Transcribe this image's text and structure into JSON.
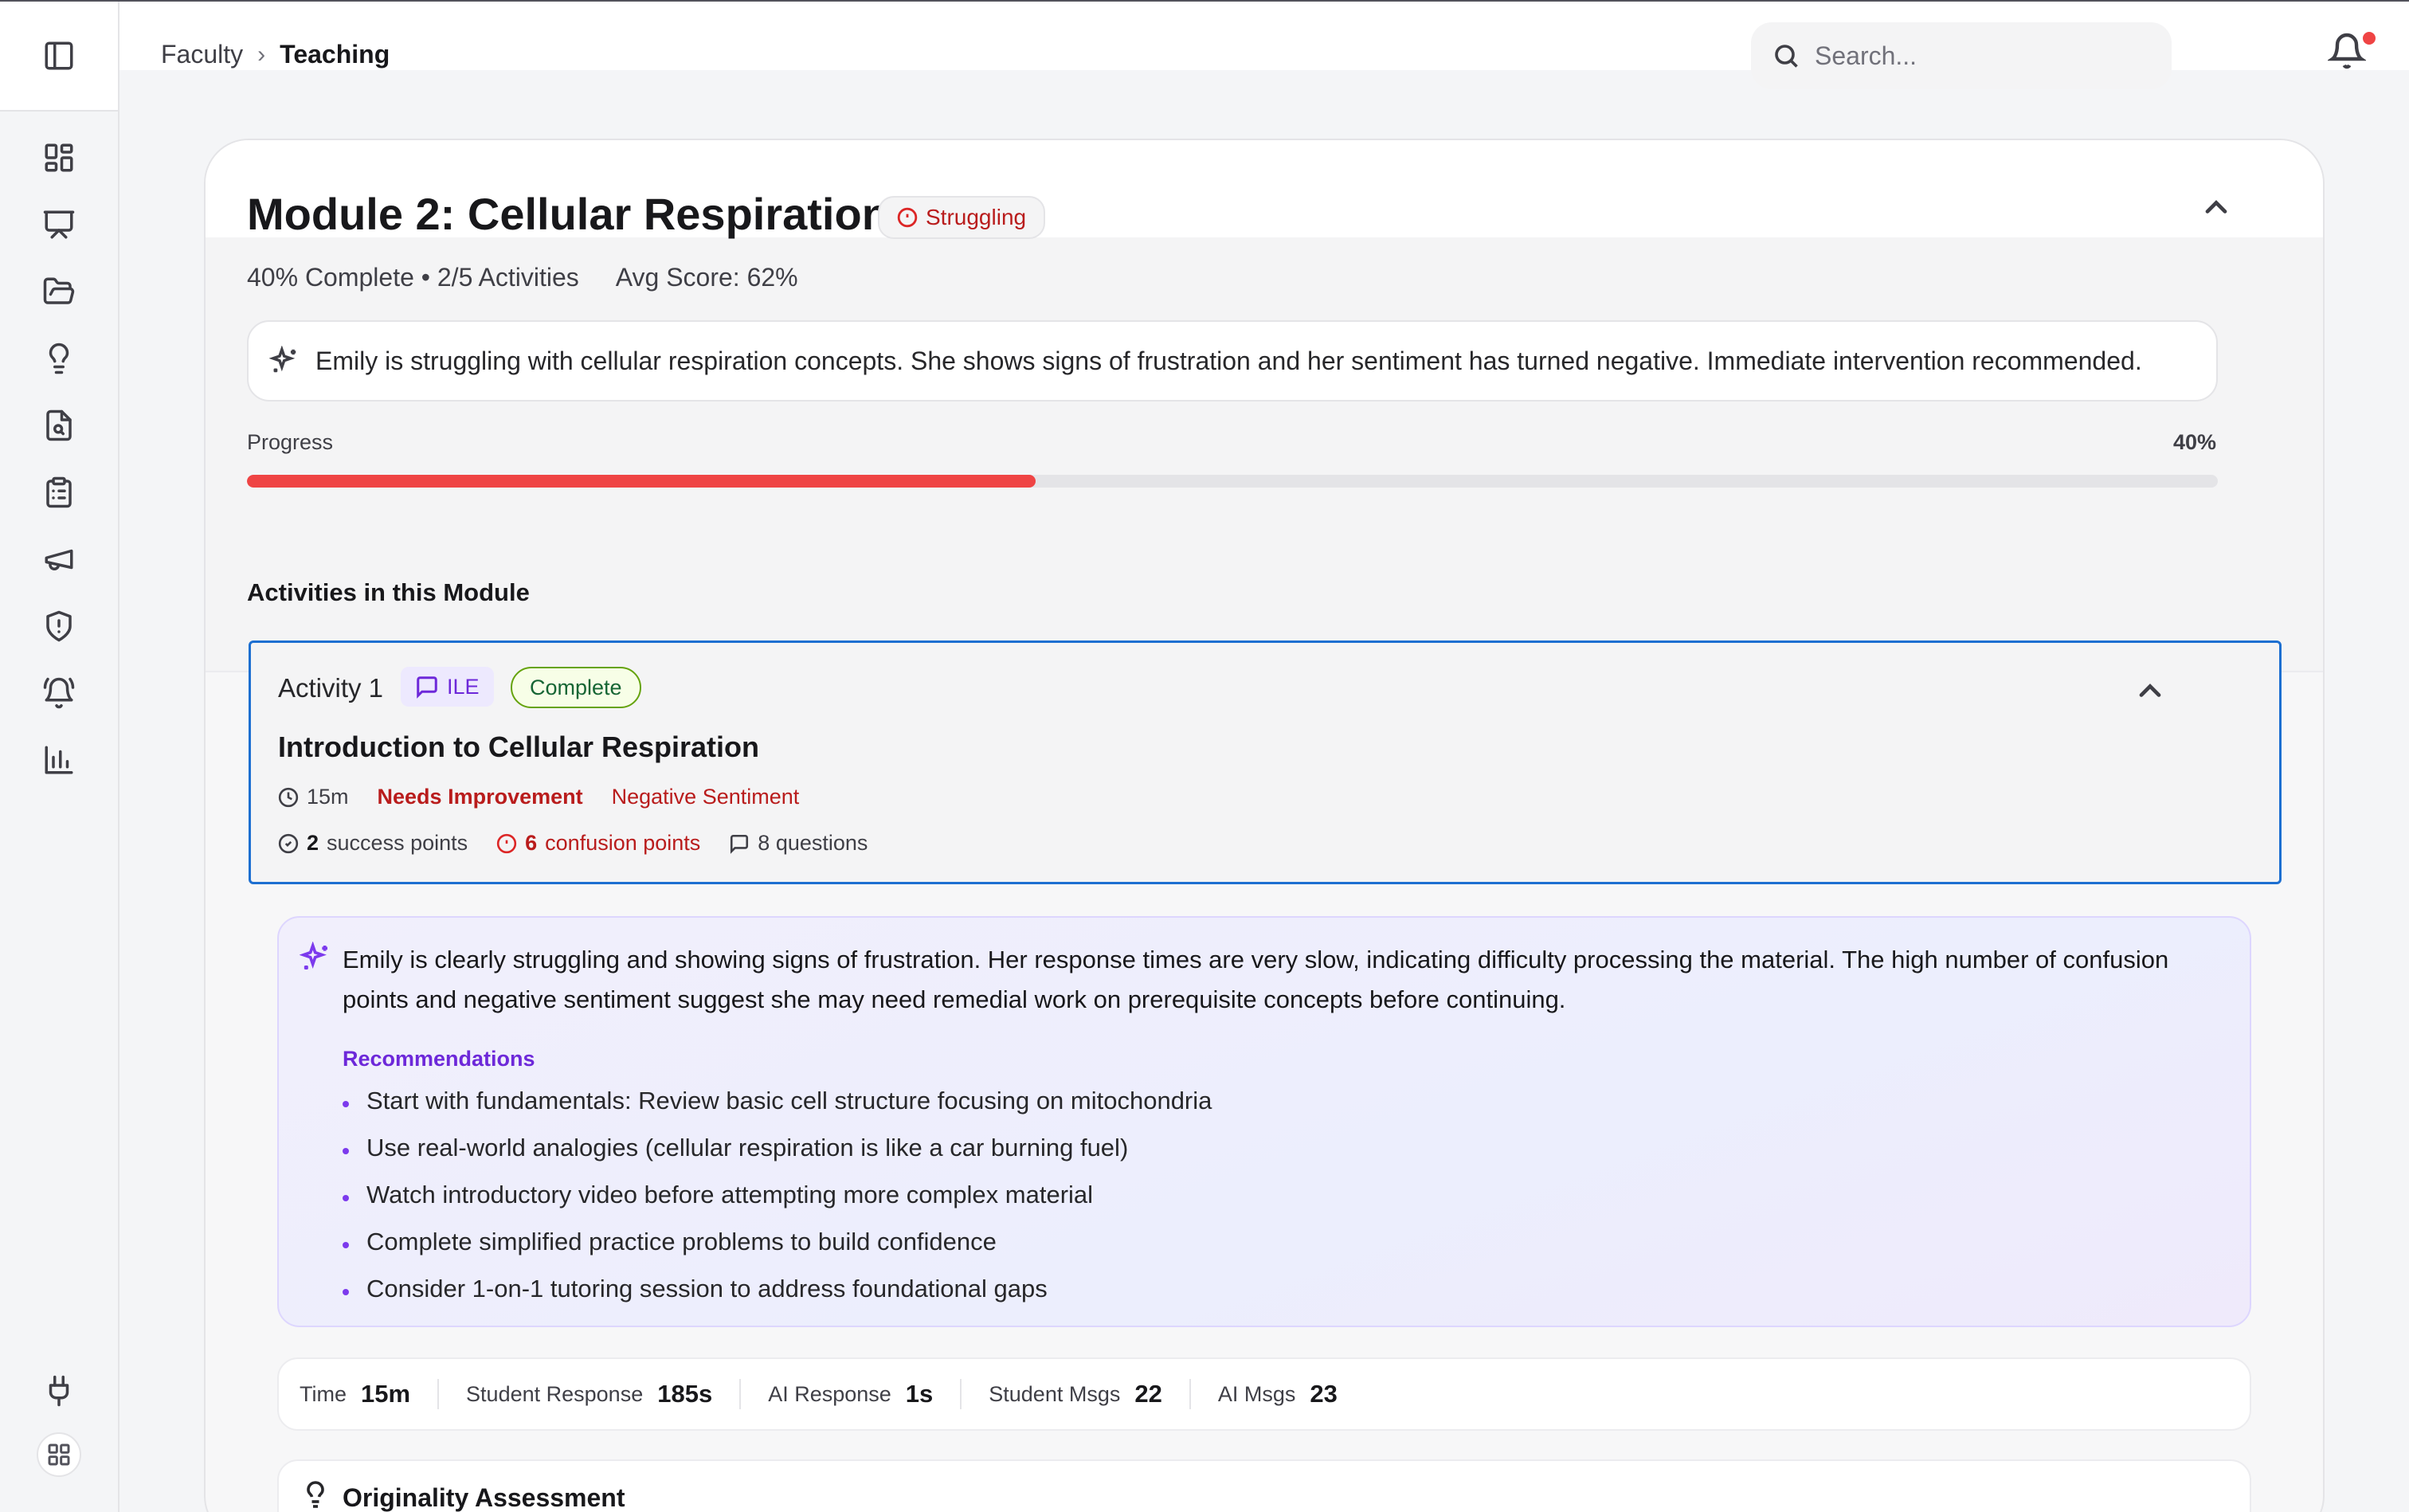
{
  "breadcrumb": {
    "parent": "Faculty",
    "separator": "›",
    "current": "Teaching"
  },
  "search": {
    "placeholder": "Search..."
  },
  "sidebar": {
    "items": [
      {
        "icon": "dashboard-icon"
      },
      {
        "icon": "presentation-icon"
      },
      {
        "icon": "folder-open-icon"
      },
      {
        "icon": "lightbulb-icon"
      },
      {
        "icon": "file-search-icon"
      },
      {
        "icon": "clipboard-list-icon"
      },
      {
        "icon": "megaphone-icon"
      },
      {
        "icon": "shield-alert-icon"
      },
      {
        "icon": "alarm-bell-icon"
      },
      {
        "icon": "bar-chart-icon"
      }
    ],
    "bottom": [
      {
        "icon": "plug-icon"
      },
      {
        "icon": "grid-icon"
      }
    ]
  },
  "module": {
    "title": "Module 2: Cellular Respiration",
    "status": "Struggling",
    "complete": "40% Complete • 2/5 Activities",
    "avg_score": "Avg Score: 62%",
    "insight": "Emily is struggling with cellular respiration concepts. She shows signs of frustration and her sentiment has turned negative. Immediate intervention recommended.",
    "progress_label": "Progress",
    "progress_text": "40%",
    "progress_fraction": 0.4
  },
  "activities_title": "Activities in this Module",
  "activity": {
    "number": "Activity 1",
    "type": "ILE",
    "status": "Complete",
    "title": "Introduction to Cellular Respiration",
    "time": "15m",
    "performance": "Needs Improvement",
    "sentiment": "Negative Sentiment",
    "success_count": "2",
    "success_label": "success points",
    "confusion_count": "6",
    "confusion_label": "confusion points",
    "questions": "8 questions"
  },
  "analysis": {
    "text": "Emily is clearly struggling and showing signs of frustration. Her response times are very slow, indicating difficulty processing the material. The high number of confusion points and negative sentiment suggest she may need remedial work on prerequisite concepts before continuing.",
    "recommendations_title": "Recommendations",
    "recommendations": [
      "Start with fundamentals: Review basic cell structure focusing on mitochondria",
      "Use real-world analogies (cellular respiration is like a car burning fuel)",
      "Watch introductory video before attempting more complex material",
      "Complete simplified practice problems to build confidence",
      "Consider 1-on-1 tutoring session to address foundational gaps"
    ]
  },
  "metrics": [
    {
      "label": "Time",
      "value": "15m"
    },
    {
      "label": "Student Response",
      "value": "185s"
    },
    {
      "label": "AI Response",
      "value": "1s"
    },
    {
      "label": "Student Msgs",
      "value": "22"
    },
    {
      "label": "AI Msgs",
      "value": "23"
    }
  ],
  "originality": {
    "title": "Originality Assessment"
  },
  "colors": {
    "accent": "#1d6fd1",
    "danger": "#ef4444",
    "ai": "#6d28d9",
    "success": "#65a30d"
  }
}
